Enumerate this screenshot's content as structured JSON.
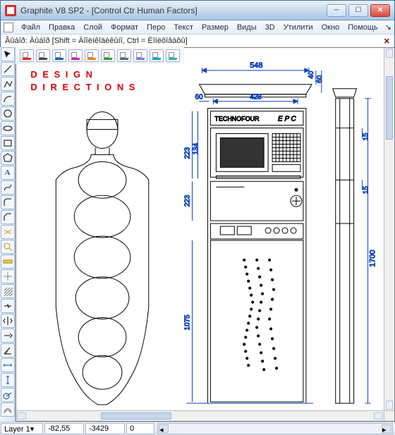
{
  "title": "Graphite V8 SP2 - [Control Ctr Human Factors]",
  "menu": [
    "Файл",
    "Правка",
    "Слой",
    "Формат",
    "Перо",
    "Текст",
    "Размер",
    "Виды",
    "3D",
    "Утилити",
    "Окно",
    "Помощь"
  ],
  "hint": "Âûáîð: Äûáîð  [Shift = Äîîëíêîäèêûíî, Ctrl = Ëîíëôîâàôû]",
  "drawing": {
    "heading1": "D E S I G N",
    "heading2": "D I R E C T I O N S",
    "brand": "TECHNOFOUR",
    "model": "E P C",
    "dims": {
      "top_width": "548",
      "right_gap": "40",
      "right_top": "60",
      "left_gap": "60",
      "inner_width": "428",
      "left_223a": "223",
      "left_134": "134",
      "left_223b": "223",
      "left_1075": "1075",
      "side_15a": "15",
      "side_15b": "15",
      "side_1700": "1700"
    }
  },
  "status": {
    "layer": "Layer 1▾",
    "x": "-82,55",
    "y": "-3429",
    "z": "0"
  }
}
